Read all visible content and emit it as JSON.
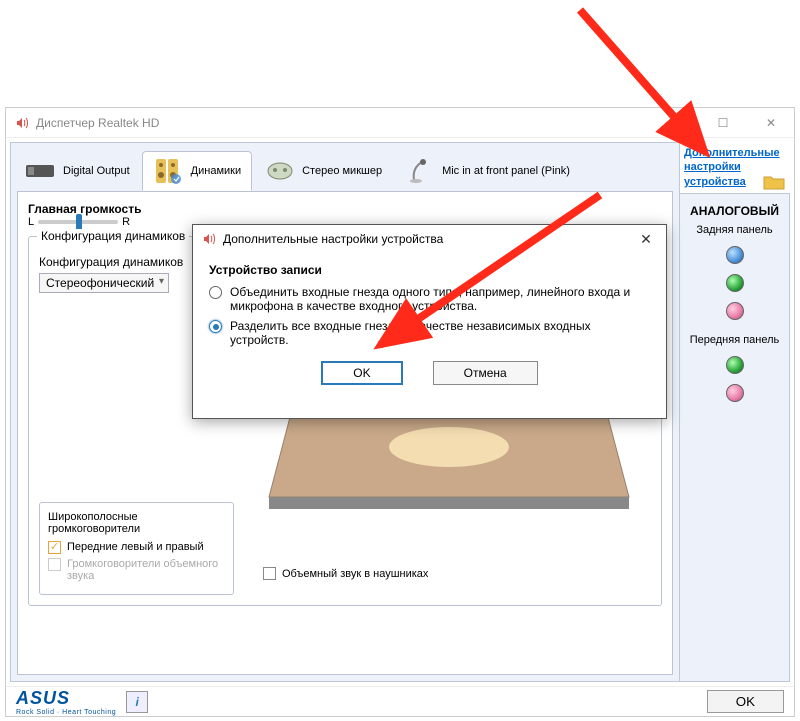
{
  "window": {
    "title": "Диспетчер Realtek HD"
  },
  "tabs": {
    "digital_output": "Digital Output",
    "speakers": "Динамики",
    "stereo_mixer": "Стерео микшер",
    "mic_front": "Mic in at front panel (Pink)"
  },
  "main": {
    "volume_label": "Главная громкость",
    "balance_L": "L",
    "balance_R": "R",
    "config_legend": "Конфигурация динамиков",
    "config_label": "Конфигурация динамиков",
    "config_value": "Стереофонический",
    "wideband_legend": "Широкополосные громкоговорители",
    "front_lr": "Передние левый и правый",
    "surround_speakers": "Громкоговорители объемного звука",
    "surround_headphones": "Объемный звук в наушниках"
  },
  "sidebar": {
    "link": "Дополнительные настройки устройства",
    "analog_heading": "АНАЛОГОВЫЙ",
    "rear_panel": "Задняя панель",
    "front_panel": "Передняя панель"
  },
  "dialog": {
    "title": "Дополнительные настройки устройства",
    "section": "Устройство записи",
    "option_merge": "Объединить входные гнезда одного типа, например, линейного входа и микрофона в качестве входного устройства.",
    "option_split": "Разделить все входные гнезда в качестве независимых входных устройств.",
    "ok": "OK",
    "cancel": "Отмена"
  },
  "footer": {
    "brand": "ASUS",
    "tagline": "Rock Solid · Heart Touching",
    "ok": "OK",
    "info": "i"
  }
}
